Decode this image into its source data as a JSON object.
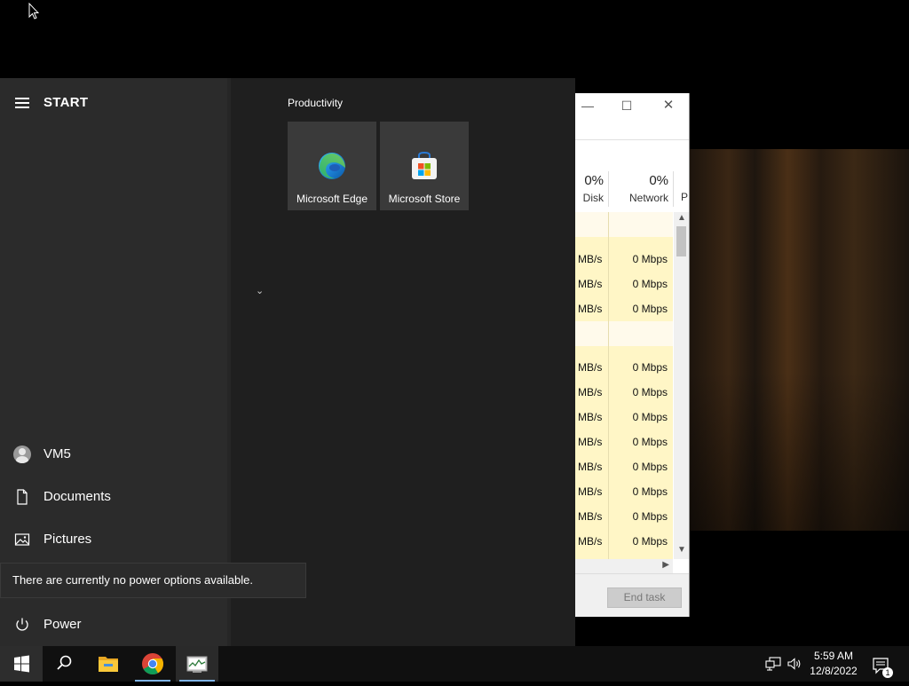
{
  "task_manager": {
    "columns": {
      "disk_pct": "0%",
      "disk_label": "Disk",
      "network_pct": "0%",
      "network_label": "Network",
      "power_label_partial": "P"
    },
    "rows": [
      {
        "disk": "",
        "net": ""
      },
      {
        "disk": "MB/s",
        "net": "0 Mbps"
      },
      {
        "disk": "MB/s",
        "net": "0 Mbps"
      },
      {
        "disk": "MB/s",
        "net": "0 Mbps"
      },
      {
        "disk": "",
        "net": ""
      },
      {
        "disk": "MB/s",
        "net": "0 Mbps"
      },
      {
        "disk": "MB/s",
        "net": "0 Mbps"
      },
      {
        "disk": "MB/s",
        "net": "0 Mbps"
      },
      {
        "disk": "MB/s",
        "net": "0 Mbps"
      },
      {
        "disk": "MB/s",
        "net": "0 Mbps"
      },
      {
        "disk": "MB/s",
        "net": "0 Mbps"
      },
      {
        "disk": "MB/s",
        "net": "0 Mbps"
      },
      {
        "disk": "MB/s",
        "net": "0 Mbps"
      }
    ],
    "end_task_label": "End task"
  },
  "start_menu": {
    "title": "START",
    "user_name": "VM5",
    "documents_label": "Documents",
    "pictures_label": "Pictures",
    "power_label": "Power",
    "power_tooltip": "There are currently no power options available.",
    "group_title": "Productivity",
    "tiles": [
      {
        "label": "Microsoft Edge",
        "icon": "edge-icon"
      },
      {
        "label": "Microsoft Store",
        "icon": "store-icon"
      }
    ]
  },
  "taskbar": {
    "apps": [
      "windows-start-icon",
      "search-icon",
      "file-explorer-icon",
      "chrome-icon",
      "task-manager-icon"
    ],
    "time": "5:59 AM",
    "date": "12/8/2022",
    "notification_count": "1"
  },
  "colors": {
    "start_bg": "#1f1f1f",
    "start_left_bg": "#2b2b2b",
    "tile_bg": "#3a3a3a",
    "taskbar_bg": "#101010",
    "row_highlight": "#fff6c6"
  }
}
